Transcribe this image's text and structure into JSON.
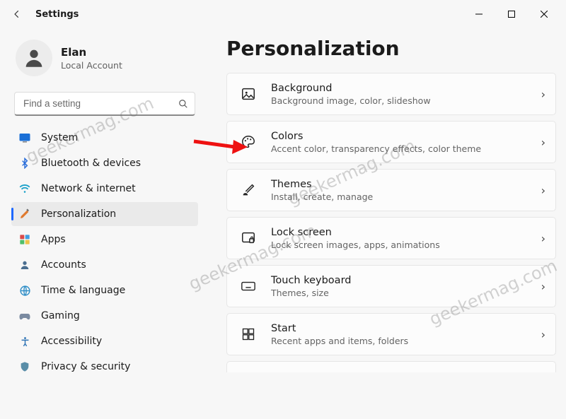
{
  "window": {
    "title": "Settings"
  },
  "account": {
    "name": "Elan",
    "subtitle": "Local Account"
  },
  "search": {
    "placeholder": "Find a setting"
  },
  "sidebar": {
    "items": [
      {
        "label": "System"
      },
      {
        "label": "Bluetooth & devices"
      },
      {
        "label": "Network & internet"
      },
      {
        "label": "Personalization"
      },
      {
        "label": "Apps"
      },
      {
        "label": "Accounts"
      },
      {
        "label": "Time & language"
      },
      {
        "label": "Gaming"
      },
      {
        "label": "Accessibility"
      },
      {
        "label": "Privacy & security"
      }
    ]
  },
  "page": {
    "heading": "Personalization"
  },
  "settings_cards": [
    {
      "title": "Background",
      "subtitle": "Background image, color, slideshow"
    },
    {
      "title": "Colors",
      "subtitle": "Accent color, transparency effects, color theme"
    },
    {
      "title": "Themes",
      "subtitle": "Install, create, manage"
    },
    {
      "title": "Lock screen",
      "subtitle": "Lock screen images, apps, animations"
    },
    {
      "title": "Touch keyboard",
      "subtitle": "Themes, size"
    },
    {
      "title": "Start",
      "subtitle": "Recent apps and items, folders"
    }
  ],
  "watermark": "geekermag.com"
}
